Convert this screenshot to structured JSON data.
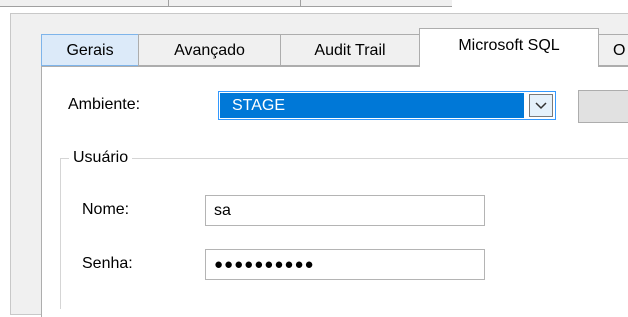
{
  "tabs": [
    {
      "label": "Gerais"
    },
    {
      "label": "Avançado"
    },
    {
      "label": "Audit Trail"
    },
    {
      "label": "Microsoft SQL"
    },
    {
      "label": "O"
    }
  ],
  "active_tab": "Microsoft SQL",
  "ambiente": {
    "label": "Ambiente:",
    "value": "STAGE"
  },
  "usuario_group": {
    "title": "Usuário",
    "nome_label": "Nome:",
    "nome_value": "sa",
    "senha_label": "Senha:",
    "senha_value": "●●●●●●●●●●"
  },
  "colors": {
    "selection": "#0078d7",
    "first_tab": "#dceaf9",
    "page_bg": "#ffffff",
    "frame_bg": "#f0f0f0"
  }
}
